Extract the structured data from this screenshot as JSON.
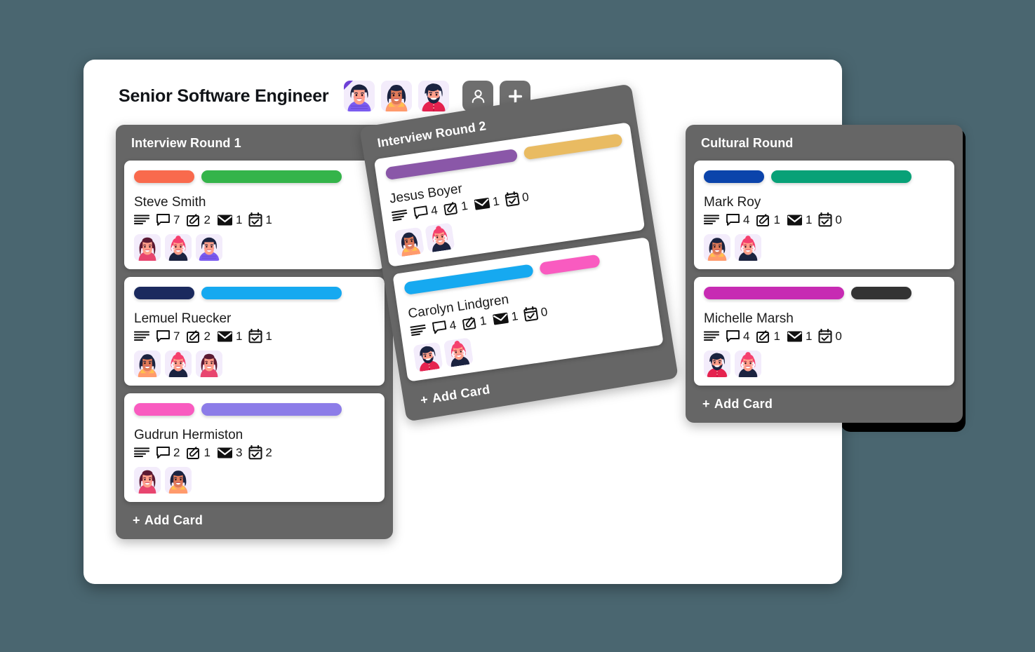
{
  "header": {
    "title": "Senior Software Engineer",
    "avatars": [
      {
        "name": "avatar-man-purple",
        "badge": true
      },
      {
        "name": "avatar-woman-orange",
        "badge": false
      },
      {
        "name": "avatar-bearded-man-red",
        "badge": false
      }
    ],
    "buttons": [
      {
        "name": "add-member-button",
        "icon": "person-icon"
      },
      {
        "name": "add-button",
        "icon": "plus-icon"
      }
    ]
  },
  "board": {
    "add_card_label": "Add  Card",
    "add_card_plus": "+",
    "columns": [
      {
        "title": "Interview Round 1",
        "cards": [
          {
            "name": "Steve Smith",
            "labels": [
              "#f96a4d",
              "#34b44a"
            ],
            "meta": {
              "comments": "7",
              "attachments": "2",
              "mails": "1",
              "tasks": "1"
            },
            "avatars": [
              "avatar-woman-darkred-hair",
              "avatar-woman-pink-bun",
              "avatar-man-purple-shirt"
            ]
          },
          {
            "name": "Lemuel Ruecker",
            "labels": [
              "#1b2a5e",
              "#16a9f0"
            ],
            "meta": {
              "comments": "7",
              "attachments": "2",
              "mails": "1",
              "tasks": "1"
            },
            "avatars": [
              "avatar-woman-orange",
              "avatar-woman-pink-bun",
              "avatar-woman-darkred-hair"
            ]
          },
          {
            "name": "Gudrun Hermiston",
            "labels": [
              "#f95bc0",
              "#8c7ce8"
            ],
            "meta": {
              "comments": "2",
              "attachments": "1",
              "mails": "3",
              "tasks": "2"
            },
            "avatars": [
              "avatar-woman-darkred-hair",
              "avatar-woman-orange"
            ]
          }
        ]
      },
      {
        "title": "Interview Round 2",
        "cards": [
          {
            "name": "Jesus Boyer",
            "labels": [
              "#8a57a8",
              "#e9bb62"
            ],
            "meta": {
              "comments": "4",
              "attachments": "1",
              "mails": "1",
              "tasks": "0"
            },
            "avatars": [
              "avatar-woman-orange",
              "avatar-woman-pink-bun"
            ]
          },
          {
            "name": "Carolyn Lindgren",
            "labels": [
              "#16a9f0",
              "#f95bc0"
            ],
            "meta": {
              "comments": "4",
              "attachments": "1",
              "mails": "1",
              "tasks": "0"
            },
            "avatars": [
              "avatar-bearded-man-red",
              "avatar-woman-pink-bun"
            ]
          }
        ]
      },
      {
        "title": "Cultural Round",
        "cards": [
          {
            "name": "Mark Roy",
            "labels": [
              "#0b44ab",
              "#08a177"
            ],
            "meta": {
              "comments": "4",
              "attachments": "1",
              "mails": "1",
              "tasks": "0"
            },
            "avatars": [
              "avatar-woman-orange",
              "avatar-woman-pink-bun"
            ]
          },
          {
            "name": "Michelle Marsh",
            "labels": [
              "#c72bb3",
              "#333333"
            ],
            "meta": {
              "comments": "4",
              "attachments": "1",
              "mails": "1",
              "tasks": "0"
            },
            "avatars": [
              "avatar-bearded-man-red",
              "avatar-woman-pink-bun"
            ]
          }
        ]
      }
    ]
  },
  "icons": {
    "description": "description-lines-icon",
    "comment": "comment-bubble-icon",
    "attachment": "paperclip-icon",
    "mail": "envelope-icon",
    "task": "calendar-check-icon"
  },
  "colors": {
    "background": "#4a6670",
    "window": "#ffffff",
    "column": "#666666",
    "button": "#6e6e6e",
    "black_panel": "#000000"
  }
}
